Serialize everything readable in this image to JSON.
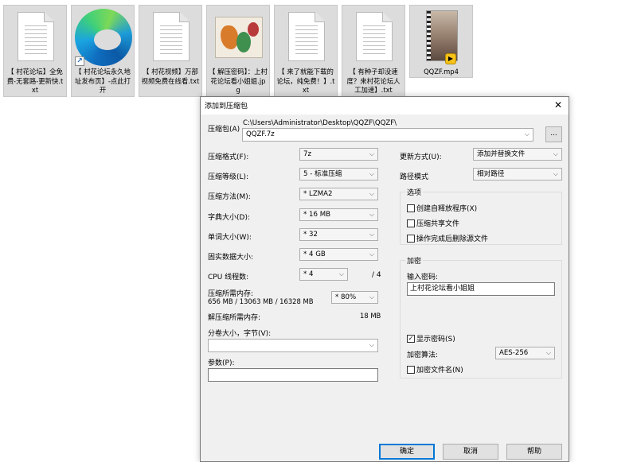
{
  "desktop": {
    "icons": [
      {
        "caption": "【 村花论坛】全免费-无套路-更新快.txt",
        "type": "txt"
      },
      {
        "caption": "【 村花论坛永久地址发布页】-点此打开",
        "type": "edge-shortcut"
      },
      {
        "caption": "【 村花视频】万部视频免费在线看.txt",
        "type": "txt"
      },
      {
        "caption": "【 解压密码】：上村花论坛看小姐姐.jpg",
        "type": "jpg"
      },
      {
        "caption": "【 来了就能下载的论坛，纯免费！】.txt",
        "type": "txt"
      },
      {
        "caption": "【 有种子却没速度？来村花论坛人工加速】.txt",
        "type": "txt"
      },
      {
        "caption": "QQZF.mp4",
        "type": "mp4"
      }
    ]
  },
  "dialog": {
    "title": "添加到压缩包",
    "close_symbol": "✕",
    "archive_label": "压缩包(A)",
    "archive_path": "C:\\Users\\Administrator\\Desktop\\QQZF\\QQZF\\",
    "archive_name": "QQZF.7z",
    "browse_label": "...",
    "left": {
      "format_label": "压缩格式(F):",
      "format_value": "7z",
      "level_label": "压缩等级(L):",
      "level_value": "5 - 标准压缩",
      "method_label": "压缩方法(M):",
      "method_value": "* LZMA2",
      "dict_label": "字典大小(D):",
      "dict_value": "* 16 MB",
      "word_label": "单词大小(W):",
      "word_value": "* 32",
      "solid_label": "固实数据大小:",
      "solid_value": "* 4 GB",
      "cpu_label": "CPU 线程数:",
      "cpu_value": "* 4",
      "cpu_total": "/ 4",
      "mem_comp_label": "压缩所需内存:",
      "mem_comp_value": "656 MB / 13063 MB / 16328 MB",
      "mem_pct": "* 80%",
      "mem_decomp_label": "解压缩所需内存:",
      "mem_decomp_value": "18 MB",
      "split_label": "分卷大小，字节(V):",
      "split_value": "",
      "params_label": "参数(P):",
      "params_value": ""
    },
    "right": {
      "update_label": "更新方式(U):",
      "update_value": "添加并替换文件",
      "pathmode_label": "路径模式",
      "pathmode_value": "相对路径",
      "options_title": "选项",
      "opt_sfx": "创建自释放程序(X)",
      "opt_shared": "压缩共享文件",
      "opt_delete": "操作完成后删除源文件",
      "encrypt_title": "加密",
      "password_label": "输入密码:",
      "password_value": "上村花论坛看小姐姐",
      "show_password": "显示密码(S)",
      "enc_method_label": "加密算法:",
      "enc_method_value": "AES-256",
      "enc_names": "加密文件名(N)",
      "check_mark": "✓"
    },
    "buttons": {
      "ok": "确定",
      "cancel": "取消",
      "help": "帮助"
    }
  }
}
